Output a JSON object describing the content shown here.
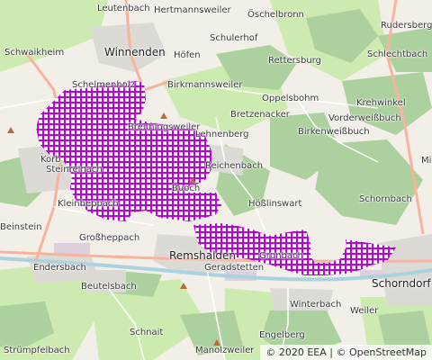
{
  "map": {
    "colors": {
      "base": "#f2efe9",
      "forest": "#add19e",
      "meadow": "#cdebb0",
      "urban": "#dcdad5",
      "industrial": "#ddd0dc",
      "water": "#aad3df",
      "road_major": "#f9b29c",
      "road_minor": "#ffffff",
      "highlight": "#bb00dd"
    },
    "labels": [
      {
        "name": "Leutenbach",
        "type": "village"
      },
      {
        "name": "Hertmannsweiler",
        "type": "village"
      },
      {
        "name": "Öschelbronn",
        "type": "village"
      },
      {
        "name": "Rudersberg",
        "type": "village"
      },
      {
        "name": "Schwaikheim",
        "type": "village"
      },
      {
        "name": "Winnenden",
        "type": "town"
      },
      {
        "name": "Schulerhof",
        "type": "village"
      },
      {
        "name": "Höfen",
        "type": "village"
      },
      {
        "name": "Schlechtbach",
        "type": "village"
      },
      {
        "name": "Rettersburg",
        "type": "village"
      },
      {
        "name": "Schelmenholz",
        "type": "village"
      },
      {
        "name": "Birkmannsweiler",
        "type": "village"
      },
      {
        "name": "Oppelsbohm",
        "type": "village"
      },
      {
        "name": "Krehwinkel",
        "type": "village"
      },
      {
        "name": "Bretzenacker",
        "type": "village"
      },
      {
        "name": "Vorderweißbuch",
        "type": "village"
      },
      {
        "name": "Breuningsweiler",
        "type": "village"
      },
      {
        "name": "Lehnenberg",
        "type": "village"
      },
      {
        "name": "Birkenweißbuch",
        "type": "village"
      },
      {
        "name": "Korb",
        "type": "village"
      },
      {
        "name": "Reichenbach",
        "type": "village"
      },
      {
        "name": "Mi",
        "type": "village"
      },
      {
        "name": "Steinreinach",
        "type": "village"
      },
      {
        "name": "Buoch",
        "type": "village"
      },
      {
        "name": "Schornbach",
        "type": "village"
      },
      {
        "name": "Kleinheppach",
        "type": "village"
      },
      {
        "name": "Hößlinswart",
        "type": "village"
      },
      {
        "name": "Beinstein",
        "type": "village"
      },
      {
        "name": "Großheppach",
        "type": "village"
      },
      {
        "name": "Remshalden",
        "type": "town"
      },
      {
        "name": "Geradstetten",
        "type": "village"
      },
      {
        "name": "Grunbach",
        "type": "village"
      },
      {
        "name": "Endersbach",
        "type": "village"
      },
      {
        "name": "Schorndorf",
        "type": "town"
      },
      {
        "name": "Beutelsbach",
        "type": "village"
      },
      {
        "name": "Winterbach",
        "type": "village"
      },
      {
        "name": "Weiler",
        "type": "village"
      },
      {
        "name": "Schnait",
        "type": "village"
      },
      {
        "name": "Strümpfelbach",
        "type": "village"
      },
      {
        "name": "Engelberg",
        "type": "village"
      },
      {
        "name": "Manolzweiler",
        "type": "village"
      }
    ],
    "attribution": {
      "eea": "© 2020 EEA",
      "separator": "|",
      "osm": "© OpenStreetMap"
    }
  }
}
